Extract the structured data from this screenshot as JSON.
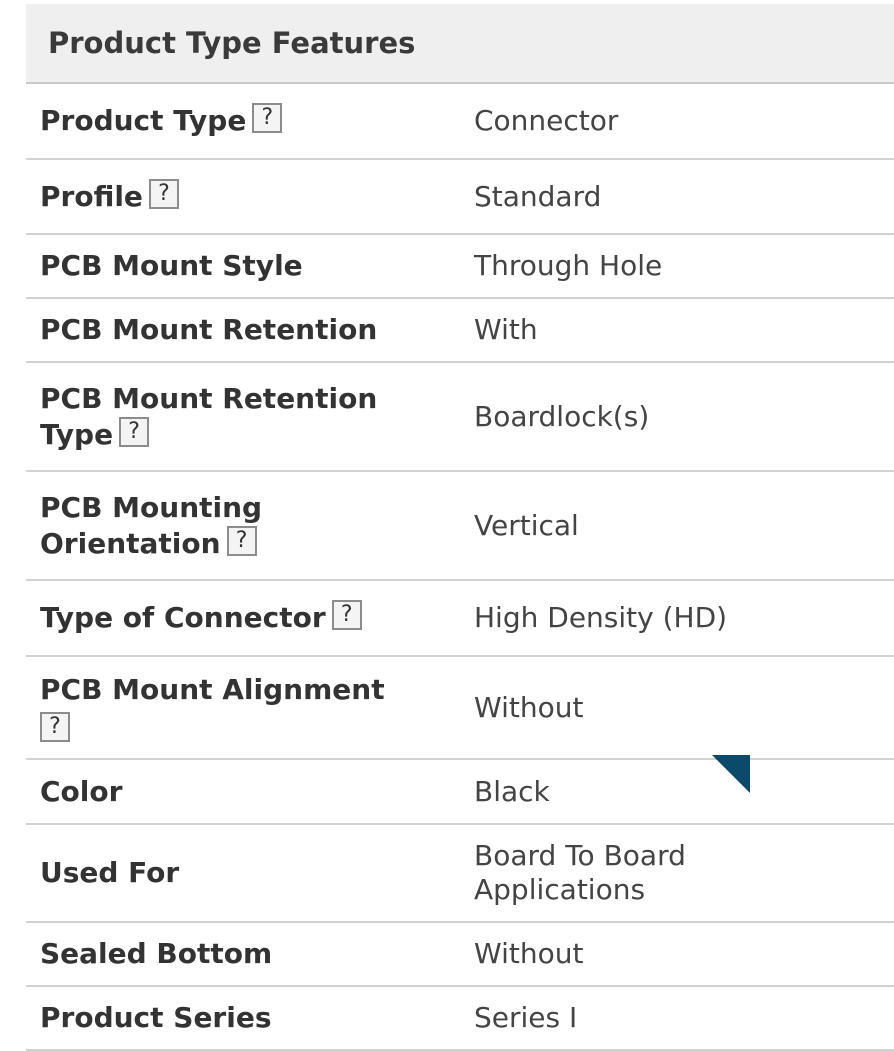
{
  "section": {
    "title": "Product Type Features"
  },
  "help_glyph": "?",
  "rows": [
    {
      "label": "Product Type",
      "value": "Connector",
      "help": true
    },
    {
      "label": "Profile",
      "value": "Standard",
      "help": true
    },
    {
      "label": "PCB Mount Style",
      "value": "Through Hole",
      "help": false
    },
    {
      "label": "PCB Mount Retention",
      "value": "With",
      "help": false
    },
    {
      "label_lines": [
        "PCB Mount Retention",
        "Type"
      ],
      "value": "Boardlock(s)",
      "help": true
    },
    {
      "label_lines": [
        "PCB Mounting",
        "Orientation"
      ],
      "value": "Vertical",
      "help": true
    },
    {
      "label": "Type of Connector",
      "value": "High Density (HD)",
      "help": true
    },
    {
      "label": "PCB Mount Alignment",
      "value": "Without",
      "help": true
    },
    {
      "label": "Color",
      "value": "Black",
      "help": false
    },
    {
      "label": "Used For",
      "value_lines": [
        "Board To Board",
        "Applications"
      ],
      "help": false
    },
    {
      "label": "Sealed Bottom",
      "value": "Without",
      "help": false
    },
    {
      "label": "Product Series",
      "value": "Series I",
      "help": false
    }
  ],
  "colors": {
    "header_bg": "#efefef",
    "divider": "#d2d2d2",
    "corner_flag": "#0b4a6a"
  }
}
